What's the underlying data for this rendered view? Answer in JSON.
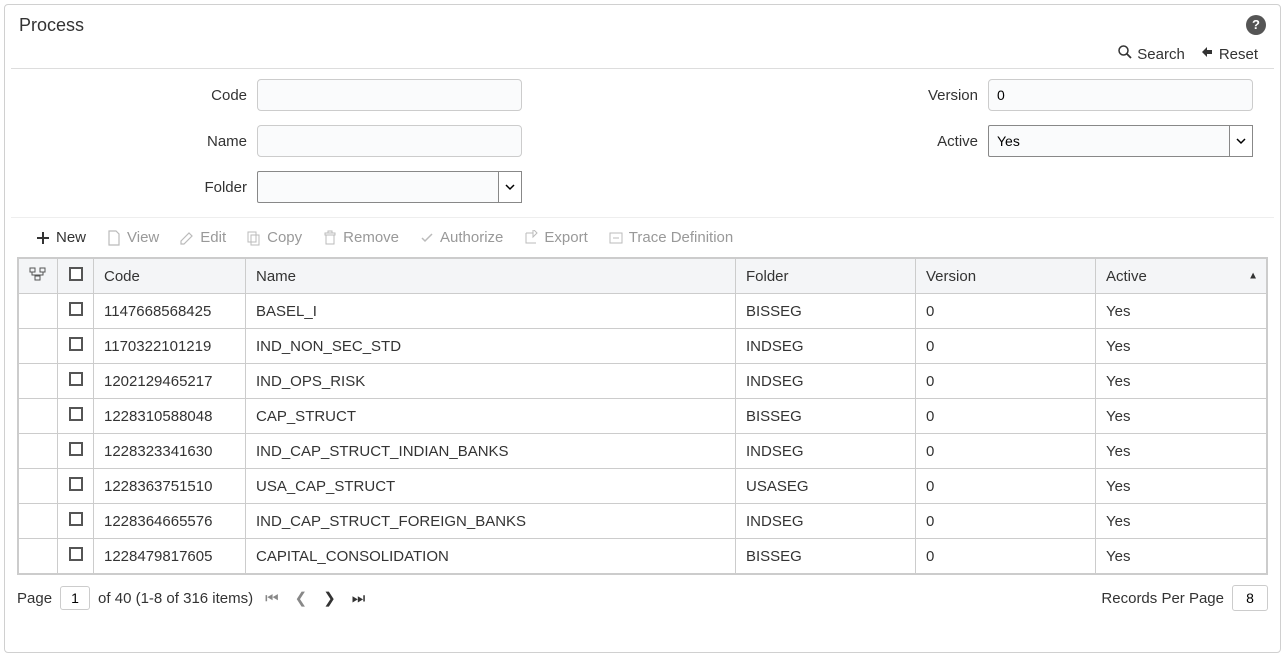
{
  "title": "Process",
  "search_label": "Search",
  "reset_label": "Reset",
  "form": {
    "code_label": "Code",
    "code_value": "",
    "version_label": "Version",
    "version_value": "0",
    "name_label": "Name",
    "name_value": "",
    "active_label": "Active",
    "active_value": "Yes",
    "folder_label": "Folder",
    "folder_value": ""
  },
  "toolbar": {
    "new": "New",
    "view": "View",
    "edit": "Edit",
    "copy": "Copy",
    "remove": "Remove",
    "authorize": "Authorize",
    "export": "Export",
    "trace": "Trace Definition"
  },
  "columns": {
    "code": "Code",
    "name": "Name",
    "folder": "Folder",
    "version": "Version",
    "active": "Active"
  },
  "rows": [
    {
      "code": "1147668568425",
      "name": "BASEL_I",
      "folder": "BISSEG",
      "version": "0",
      "active": "Yes"
    },
    {
      "code": "1170322101219",
      "name": "IND_NON_SEC_STD",
      "folder": "INDSEG",
      "version": "0",
      "active": "Yes"
    },
    {
      "code": "1202129465217",
      "name": "IND_OPS_RISK",
      "folder": "INDSEG",
      "version": "0",
      "active": "Yes"
    },
    {
      "code": "1228310588048",
      "name": "CAP_STRUCT",
      "folder": "BISSEG",
      "version": "0",
      "active": "Yes"
    },
    {
      "code": "1228323341630",
      "name": "IND_CAP_STRUCT_INDIAN_BANKS",
      "folder": "INDSEG",
      "version": "0",
      "active": "Yes"
    },
    {
      "code": "1228363751510",
      "name": "USA_CAP_STRUCT",
      "folder": "USASEG",
      "version": "0",
      "active": "Yes"
    },
    {
      "code": "1228364665576",
      "name": "IND_CAP_STRUCT_FOREIGN_BANKS",
      "folder": "INDSEG",
      "version": "0",
      "active": "Yes"
    },
    {
      "code": "1228479817605",
      "name": "CAPITAL_CONSOLIDATION",
      "folder": "BISSEG",
      "version": "0",
      "active": "Yes"
    }
  ],
  "pager": {
    "page_label": "Page",
    "current_page": "1",
    "of_text": "of 40  (1-8 of  316 items)",
    "rpp_label": "Records Per Page",
    "rpp_value": "8"
  }
}
